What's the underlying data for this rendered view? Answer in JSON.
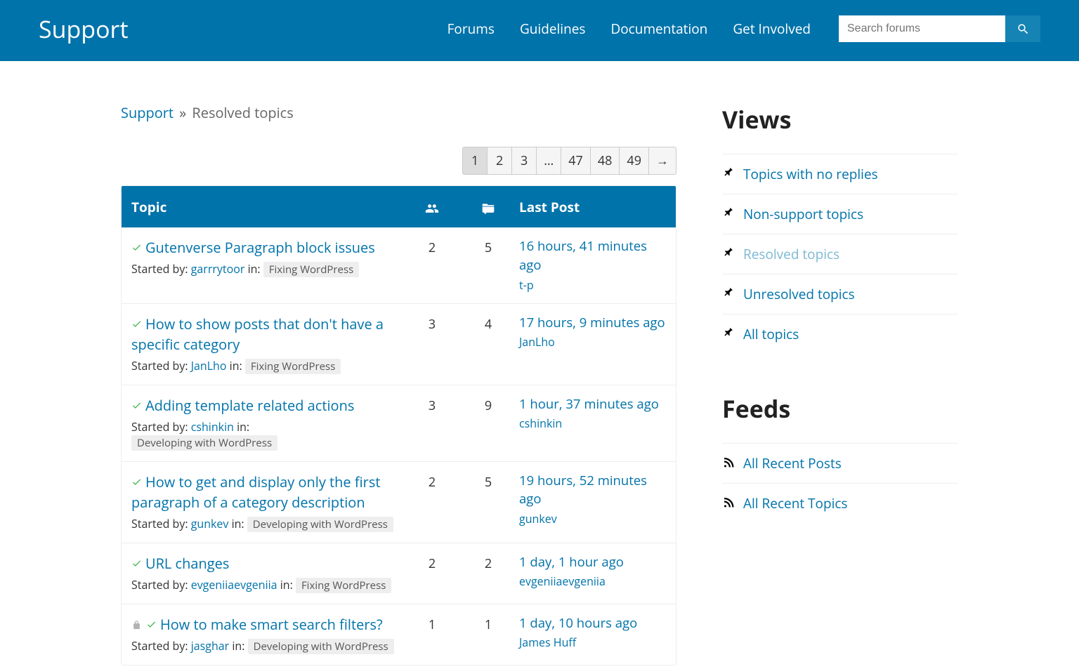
{
  "header": {
    "title": "Support",
    "nav": [
      "Forums",
      "Guidelines",
      "Documentation",
      "Get Involved"
    ],
    "search_placeholder": "Search forums"
  },
  "breadcrumb": {
    "root": "Support",
    "sep": "»",
    "current": "Resolved topics"
  },
  "pagination": {
    "pages": [
      "1",
      "2",
      "3",
      "…",
      "47",
      "48",
      "49"
    ],
    "current": "1",
    "arrow": "→"
  },
  "table": {
    "cols": {
      "topic": "Topic",
      "lastpost": "Last Post"
    },
    "started_by_prefix": "Started by: ",
    "in_prefix": " in: "
  },
  "topics": [
    {
      "title": "Gutenverse Paragraph block issues",
      "voices": "2",
      "replies": "5",
      "lp_time": "16 hours, 41 minutes ago",
      "lp_user": "t-p",
      "user": "garrrytoor",
      "forum": "Fixing WordPress",
      "locked": false
    },
    {
      "title": "How to show posts that don't have a specific category",
      "voices": "3",
      "replies": "4",
      "lp_time": "17 hours, 9 minutes ago",
      "lp_user": "JanLho",
      "user": "JanLho",
      "forum": "Fixing WordPress",
      "locked": false
    },
    {
      "title": "Adding template related actions",
      "voices": "3",
      "replies": "9",
      "lp_time": "1 hour, 37 minutes ago",
      "lp_user": "cshinkin",
      "user": "cshinkin",
      "forum": "Developing with WordPress",
      "locked": false
    },
    {
      "title": "How to get and display only the first paragraph of a category description",
      "voices": "2",
      "replies": "5",
      "lp_time": "19 hours, 52 minutes ago",
      "lp_user": "gunkev",
      "user": "gunkev",
      "forum": "Developing with WordPress",
      "locked": false
    },
    {
      "title": "URL changes",
      "voices": "2",
      "replies": "2",
      "lp_time": "1 day, 1 hour ago",
      "lp_user": "evgeniiaevgeniia",
      "user": "evgeniiaevgeniia",
      "forum": "Fixing WordPress",
      "locked": false
    },
    {
      "title": "How to make smart search filters?",
      "voices": "1",
      "replies": "1",
      "lp_time": "1 day, 10 hours ago",
      "lp_user": "James Huff",
      "user": "jasghar",
      "forum": "Developing with WordPress",
      "locked": true
    }
  ],
  "sidebar": {
    "views_title": "Views",
    "feeds_title": "Feeds",
    "views": [
      {
        "label": "Topics with no replies",
        "active": false
      },
      {
        "label": "Non-support topics",
        "active": false
      },
      {
        "label": "Resolved topics",
        "active": true
      },
      {
        "label": "Unresolved topics",
        "active": false
      },
      {
        "label": "All topics",
        "active": false
      }
    ],
    "feeds": [
      {
        "label": "All Recent Posts"
      },
      {
        "label": "All Recent Topics"
      }
    ]
  }
}
